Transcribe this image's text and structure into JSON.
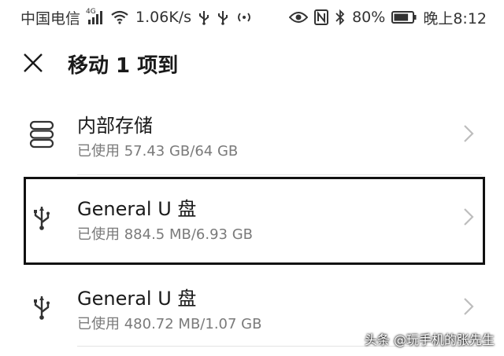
{
  "status_bar": {
    "carrier": "中国电信",
    "network_type": "4G",
    "speed": "1.06K/s",
    "battery": "80%",
    "time": "晚上8:12"
  },
  "header": {
    "title": "移动 1 项到"
  },
  "storage": [
    {
      "name": "内部存储",
      "usage": "已使用 57.43 GB/64 GB",
      "icon": "storage-icon"
    },
    {
      "name": "General U 盘",
      "usage": "已使用 884.5 MB/6.93 GB",
      "icon": "usb-icon"
    },
    {
      "name": "General U 盘",
      "usage": "已使用 480.72 MB/1.07 GB",
      "icon": "usb-icon"
    }
  ],
  "watermark": "头条 @玩手机的张先生",
  "colors": {
    "text": "#1a1a1a",
    "secondary": "#7a7a7a",
    "highlight_border": "#111111"
  }
}
